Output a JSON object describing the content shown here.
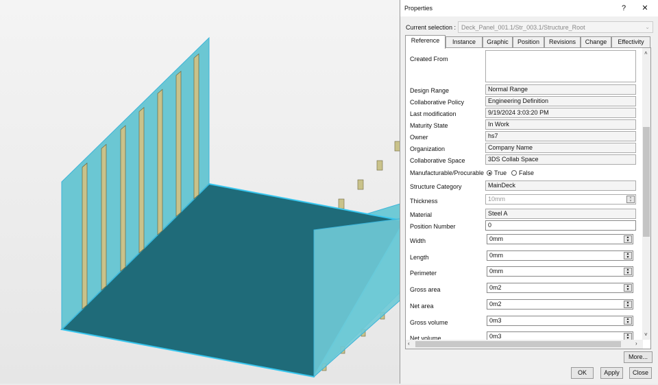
{
  "dialog": {
    "title": "Properties",
    "help_label": "?",
    "close_label": "✕",
    "current_selection_label": "Current selection :",
    "current_selection_value": "Deck_Panel_001.1/Str_003.1/Structure_Root",
    "tabs": [
      "Reference",
      "Instance",
      "Graphic",
      "Position",
      "Revisions",
      "Change",
      "Effectivity"
    ],
    "active_tab": "Reference",
    "created_from_label": "Created From",
    "rows": [
      {
        "label": "Design Range",
        "value": "Normal Range"
      },
      {
        "label": "Collaborative Policy",
        "value": "Engineering Definition"
      },
      {
        "label": "Last modification",
        "value": "9/19/2024 3:03:20 PM"
      },
      {
        "label": "Maturity State",
        "value": "In Work"
      },
      {
        "label": "Owner",
        "value": "hs7"
      },
      {
        "label": "Organization",
        "value": "Company Name"
      },
      {
        "label": "Collaborative Space",
        "value": "3DS Collab Space"
      }
    ],
    "manufacturable": {
      "label": "Manufacturable/Procurable",
      "true_label": "True",
      "false_label": "False",
      "selected": "True"
    },
    "structure_category": {
      "label": "Structure Category",
      "value": "MainDeck"
    },
    "thickness": {
      "label": "Thickness",
      "value": "10mm"
    },
    "material": {
      "label": "Material",
      "value": "Steel A"
    },
    "position_number": {
      "label": "Position Number",
      "value": "0"
    },
    "spin_rows": [
      {
        "label": "Width",
        "value": "0mm"
      },
      {
        "label": "Length",
        "value": "0mm"
      },
      {
        "label": "Perimeter",
        "value": "0mm"
      },
      {
        "label": "Gross area",
        "value": "0m2"
      },
      {
        "label": "Net area",
        "value": "0m2"
      },
      {
        "label": "Gross volume",
        "value": "0m3"
      },
      {
        "label": "Net volume",
        "value": "0m3"
      }
    ],
    "more_label": "More...",
    "ok_label": "OK",
    "apply_label": "Apply",
    "close_button_label": "Close"
  },
  "viewport": {
    "wall_color": "#5fc3d0",
    "floor_color": "#1e6a78",
    "stiffener_color": "#c9c28a"
  }
}
